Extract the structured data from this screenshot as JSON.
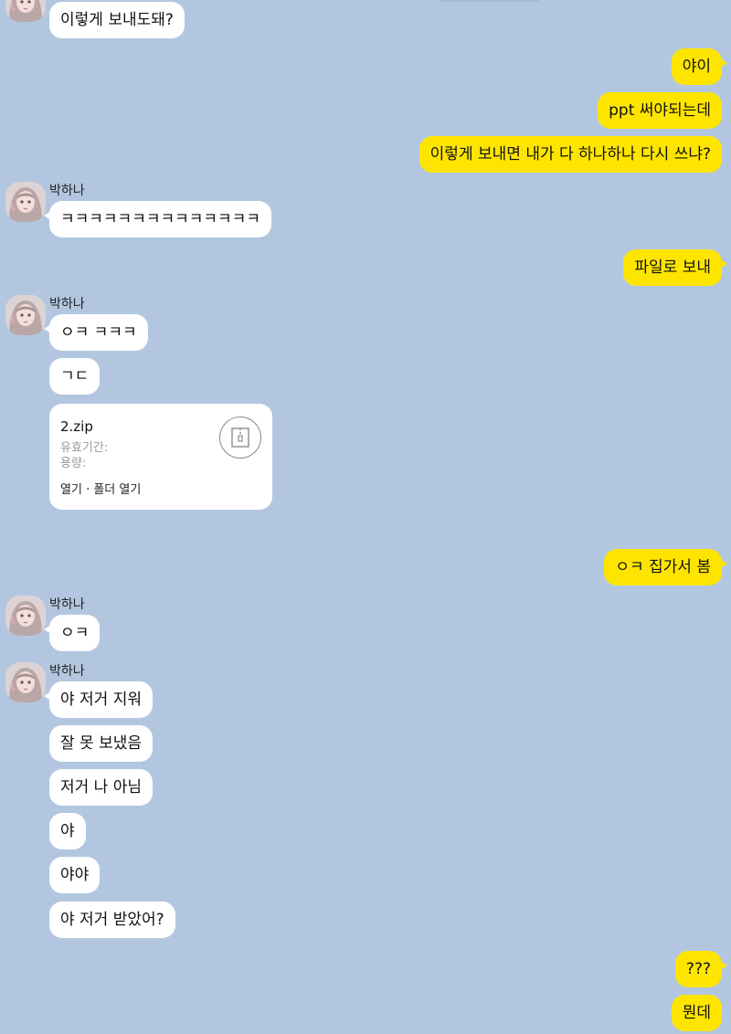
{
  "chat": {
    "sender_name": "박하나",
    "messages": {
      "m1": "이렇게 보내도돼?",
      "m2": "야이",
      "m3": "ppt 써야되는데",
      "m4": "이렇게 보내면 내가 다 하나하나 다시 쓰냐?",
      "m5": "ㅋㅋㅋㅋㅋㅋㅋㅋㅋㅋㅋㅋㅋㅋ",
      "m6": "파일로 보내",
      "m7": "ㅇㅋ ㅋㅋㅋ",
      "m8": "ㄱㄷ",
      "m9": "ㅇㅋ 집가서 봄",
      "m10": "ㅇㅋ",
      "m11": "야 저거 지워",
      "m12": "잘 못 보냈음",
      "m13": "저거 나 아님",
      "m14": "야",
      "m15": "야야",
      "m16": "야 저거 받았어?",
      "m17": "???",
      "m18": "뭔데"
    },
    "file": {
      "name": "2.zip",
      "expiry_label": "유효기간:",
      "size_label": "용량:",
      "open_label": "열기",
      "separator": "·",
      "folder_open_label": "폴더 열기",
      "icon": "zip-file-icon"
    }
  },
  "colors": {
    "background": "#b2c7df",
    "incoming_bubble": "#ffffff",
    "outgoing_bubble": "#fee500"
  }
}
